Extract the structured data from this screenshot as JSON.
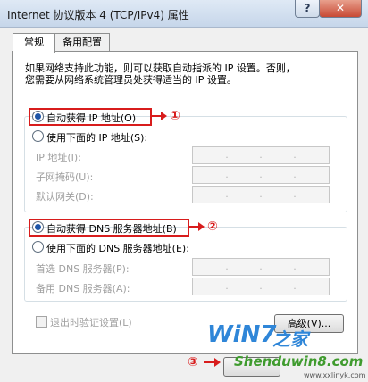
{
  "window": {
    "title": "Internet 协议版本 4 (TCP/IPv4) 属性",
    "help_glyph": "?",
    "close_glyph": "✕"
  },
  "tabs": [
    {
      "label": "常规",
      "active": true
    },
    {
      "label": "备用配置",
      "active": false
    }
  ],
  "description": {
    "line1": "如果网络支持此功能，则可以获取自动指派的 IP 设置。否则，",
    "line2": "您需要从网络系统管理员处获得适当的 IP 设置。"
  },
  "ip_section": {
    "auto_label": "自动获得 IP 地址(O)",
    "manual_label": "使用下面的 IP 地址(S):",
    "fields": [
      {
        "label": "IP 地址(I):"
      },
      {
        "label": "子网掩码(U):"
      },
      {
        "label": "默认网关(D):"
      }
    ],
    "auto_selected": true
  },
  "dns_section": {
    "auto_label": "自动获得 DNS 服务器地址(B)",
    "manual_label": "使用下面的 DNS 服务器地址(E):",
    "fields": [
      {
        "label": "首选 DNS 服务器(P):"
      },
      {
        "label": "备用 DNS 服务器(A):"
      }
    ],
    "auto_selected": true
  },
  "validate_checkbox": {
    "label": "退出时验证设置(L)",
    "checked": false
  },
  "advanced_button": {
    "label": "高级(V)..."
  },
  "ip_separator": ".",
  "annotations": {
    "m1": "①",
    "m2": "②",
    "m3": "③"
  },
  "watermark": {
    "brand": "WiN7",
    "brand_suffix": "之家",
    "site": "Shenduwin8.com",
    "url": "www.xxlinyk.com"
  },
  "colors": {
    "annotation_red": "#d81c1c",
    "selected_radio": "#1e56a8",
    "title_gradient_top": "#dfe9f5"
  }
}
